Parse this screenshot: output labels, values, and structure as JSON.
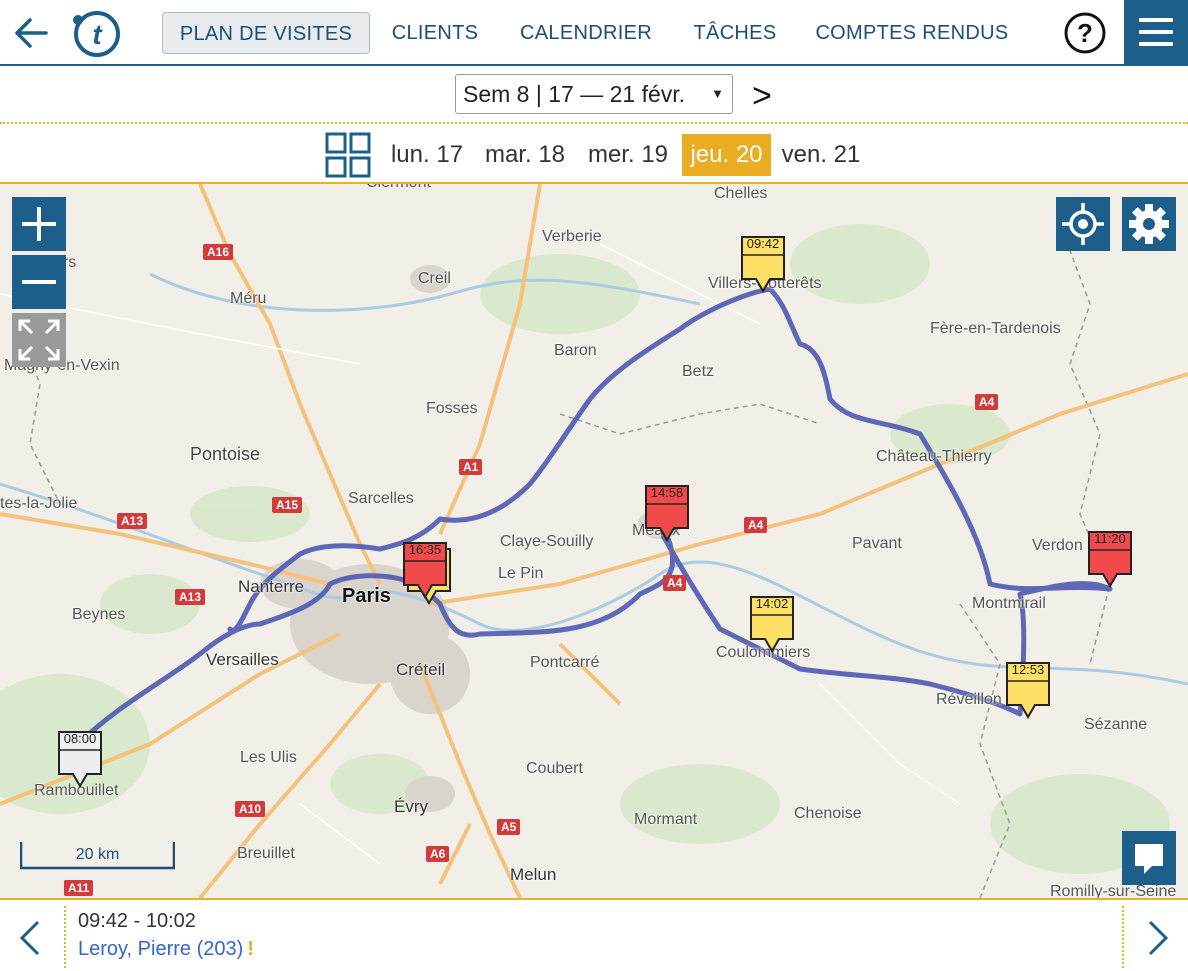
{
  "nav": {
    "plan": "PLAN DE VISITES",
    "clients": "CLIENTS",
    "calendar": "CALENDRIER",
    "tasks": "TÂCHES",
    "reports": "COMPTES RENDUS"
  },
  "week": {
    "label": "Sem 8 | 17 — 21 févr.",
    "caret": "▼",
    "next": ">"
  },
  "days": [
    {
      "label": "lun. 17"
    },
    {
      "label": "mar. 18"
    },
    {
      "label": "mer. 19"
    },
    {
      "label": "jeu. 20",
      "selected": true
    },
    {
      "label": "ven. 21"
    }
  ],
  "map": {
    "places": [
      "Clermont",
      "Chelles",
      "Verberie",
      "Gisors",
      "Creil",
      "Méru",
      "Villers-Cotterêts",
      "Fère-en-Tardenois",
      "Magny-en-Vexin",
      "Baron",
      "Betz",
      "Fosses",
      "Pontoise",
      "Château-Thierry",
      "Sarcelles",
      "tes-la-Jolie",
      "Meaux",
      "Claye-Souilly",
      "Pavant",
      "Verdon",
      "Le Pin",
      "Nanterre",
      "Paris",
      "Montmirail",
      "Beynes",
      "Coulommiers",
      "Versailles",
      "Créteil",
      "Pontcarré",
      "Réveillon",
      "Sézanne",
      "Les Ulis",
      "Coubert",
      "Rambouillet",
      "Évry",
      "Mormant",
      "Chenoise",
      "Breuillet",
      "Melun",
      "Romilly-sur-Seine"
    ],
    "roads": [
      "A16",
      "A1",
      "A15",
      "A13",
      "A13",
      "A4",
      "A4",
      "A4",
      "A10",
      "A5",
      "A6",
      "A11"
    ],
    "markers": [
      {
        "time": "09:42",
        "status": "yellow"
      },
      {
        "time": "16:35",
        "status": "red"
      },
      {
        "time": "14:58",
        "status": "red"
      },
      {
        "time": "11:20",
        "status": "red"
      },
      {
        "time": "14:02",
        "status": "yellow"
      },
      {
        "time": "12:53",
        "status": "yellow"
      },
      {
        "time": "08:00",
        "status": "start"
      }
    ],
    "scale": "20 km"
  },
  "colors": {
    "accent": "#e8ad22",
    "primary": "#1d5f8b",
    "route": "#5560b4",
    "red": "#f04a4a",
    "yellow": "#ffe066"
  },
  "footer": {
    "time": "09:42 - 10:02",
    "client": "Leroy, Pierre (203)",
    "warn": "!"
  }
}
